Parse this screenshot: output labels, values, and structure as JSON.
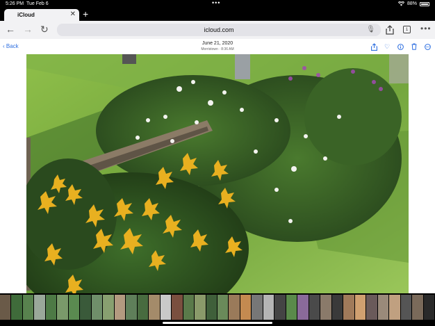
{
  "status": {
    "time": "5:26 PM",
    "date": "Tue Feb 6",
    "battery": "88%"
  },
  "tab": {
    "title": "iCloud"
  },
  "address": {
    "url": "icloud.com",
    "tab_count": "1"
  },
  "header": {
    "back_label": "Back",
    "title": "June 21, 2020",
    "subtitle": "Morristown · 8:36 AM"
  },
  "icons": {
    "back": "arrow-left-icon",
    "forward": "arrow-right-icon",
    "reload": "reload-icon",
    "share": "share-icon",
    "tabs": "tabs-icon",
    "more": "more-icon",
    "favorite": "heart-icon",
    "info": "info-icon",
    "delete": "trash-icon",
    "options": "ellipsis-circle-icon"
  },
  "colors": {
    "accent": "#2e6fe0",
    "toolbar": "#f2f2f4",
    "address_bg": "#e3e3e8"
  },
  "filmstrip": {
    "thumbnails": [
      {
        "color": "#6a5a48"
      },
      {
        "color": "#3f6b3a"
      },
      {
        "color": "#58824e"
      },
      {
        "color": "#9aa89a"
      },
      {
        "color": "#4d7a45"
      },
      {
        "color": "#7a9a6a"
      },
      {
        "color": "#5a8a50"
      },
      {
        "color": "#3a5a3a"
      },
      {
        "color": "#6f8f6a"
      },
      {
        "color": "#88a070"
      },
      {
        "color": "#b39a80"
      },
      {
        "color": "#5f7f5a"
      },
      {
        "color": "#486b3f"
      },
      {
        "color": "#a48b6a"
      },
      {
        "color": "#c9c9c9"
      },
      {
        "color": "#7a4f3f"
      },
      {
        "color": "#5a7a4a"
      },
      {
        "color": "#8a9a6a"
      },
      {
        "color": "#3f5f3a"
      },
      {
        "color": "#6a8a5a"
      },
      {
        "color": "#9a7a5a"
      },
      {
        "color": "#c48a50"
      },
      {
        "color": "#777777"
      },
      {
        "color": "#b5b5b5"
      },
      {
        "color": "#444444"
      },
      {
        "color": "#5a8a4a"
      },
      {
        "color": "#8a6a9a"
      },
      {
        "color": "#4a4a4a"
      },
      {
        "color": "#8a7a6a"
      },
      {
        "color": "#3a3a3a"
      },
      {
        "color": "#a07a5a"
      },
      {
        "color": "#d0a070"
      },
      {
        "color": "#6a5a5a"
      },
      {
        "color": "#9a8a7a"
      },
      {
        "color": "#c0a080"
      },
      {
        "color": "#555555"
      },
      {
        "color": "#7a6a5a"
      },
      {
        "color": "#2a2a2a"
      }
    ]
  }
}
